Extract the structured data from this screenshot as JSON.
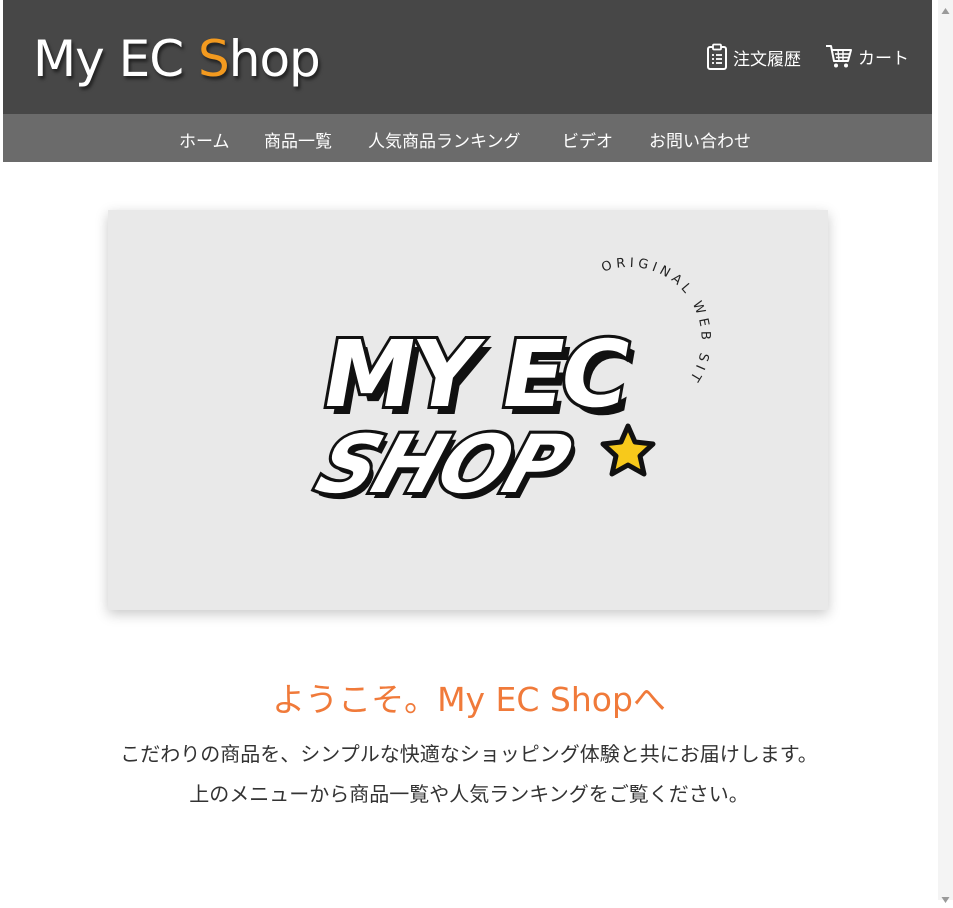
{
  "header": {
    "logo_main": "My EC ",
    "logo_accent": "S",
    "logo_rest": "hop",
    "orders_label": "注文履歴",
    "cart_label": "カート"
  },
  "nav": {
    "items": [
      "ホーム",
      "商品一覧",
      "人気商品ランキング",
      "ビデオ",
      "お問い合わせ"
    ]
  },
  "hero": {
    "brand_line1": "MY EC",
    "brand_line2": "SHOP",
    "curved_text": "ORIGINAL WEB SITE"
  },
  "welcome": {
    "title": "ようこそ。My EC Shopへ",
    "line1": "こだわりの商品を、シンプルな快適なショッピング体験と共にお届けします。",
    "line2": "上のメニューから商品一覧や人気ランキングをご覧ください。"
  },
  "colors": {
    "header_bg": "#474747",
    "nav_bg": "#6b6b6b",
    "logo_accent": "#f39a1f",
    "welcome_title": "#f07a3a",
    "hero_bg": "#e9e9e9",
    "star": "#f7c91b"
  },
  "icons": {
    "orders": "clipboard-icon",
    "cart": "cart-icon"
  }
}
